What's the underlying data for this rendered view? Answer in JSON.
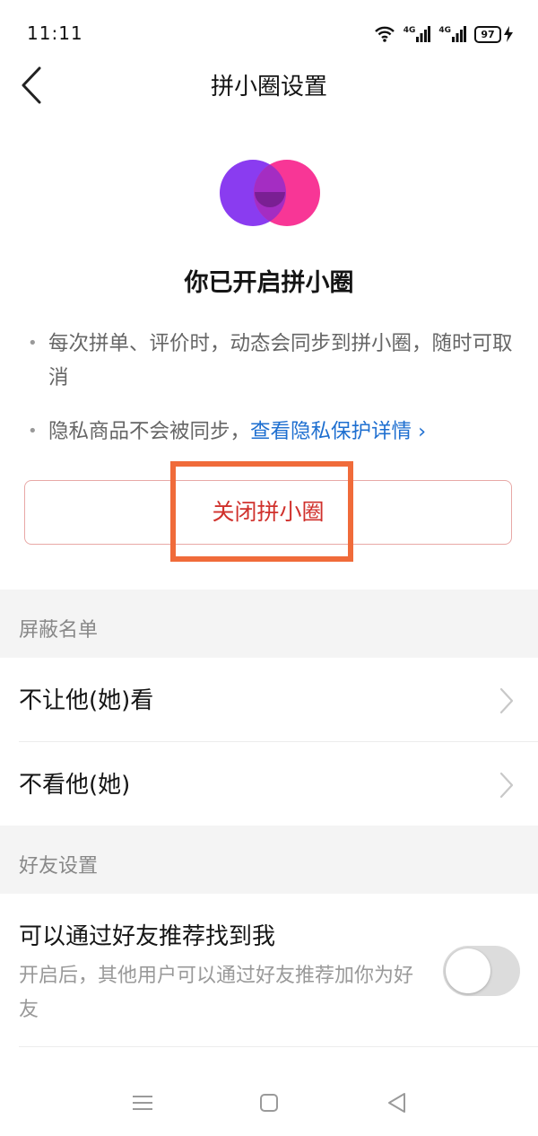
{
  "status_bar": {
    "time": "11:11",
    "battery": "97",
    "network_1": "4G",
    "network_2": "4G"
  },
  "nav": {
    "title": "拼小圈设置"
  },
  "hero": {
    "heading": "你已开启拼小圈"
  },
  "info": {
    "bullet_1": "每次拼单、评价时，动态会同步到拼小圈，随时可取消",
    "bullet_2_prefix": "隐私商品不会被同步，",
    "bullet_2_link": "查看隐私保护详情 ›"
  },
  "close_button_label": "关闭拼小圈",
  "block_list": {
    "header": "屏蔽名单",
    "items": [
      {
        "label": "不让他(她)看"
      },
      {
        "label": "不看他(她)"
      }
    ]
  },
  "friend_settings": {
    "header": "好友设置",
    "recommend": {
      "title": "可以通过好友推荐找到我",
      "description": "开启后，其他用户可以通过好友推荐加你为好友",
      "enabled": false
    }
  },
  "colors": {
    "accent_red": "#d0312c",
    "link_blue": "#1e6fd0",
    "logo_purple": "#8a3cf0",
    "logo_pink": "#f83696",
    "highlight_orange": "#f06b3a"
  }
}
